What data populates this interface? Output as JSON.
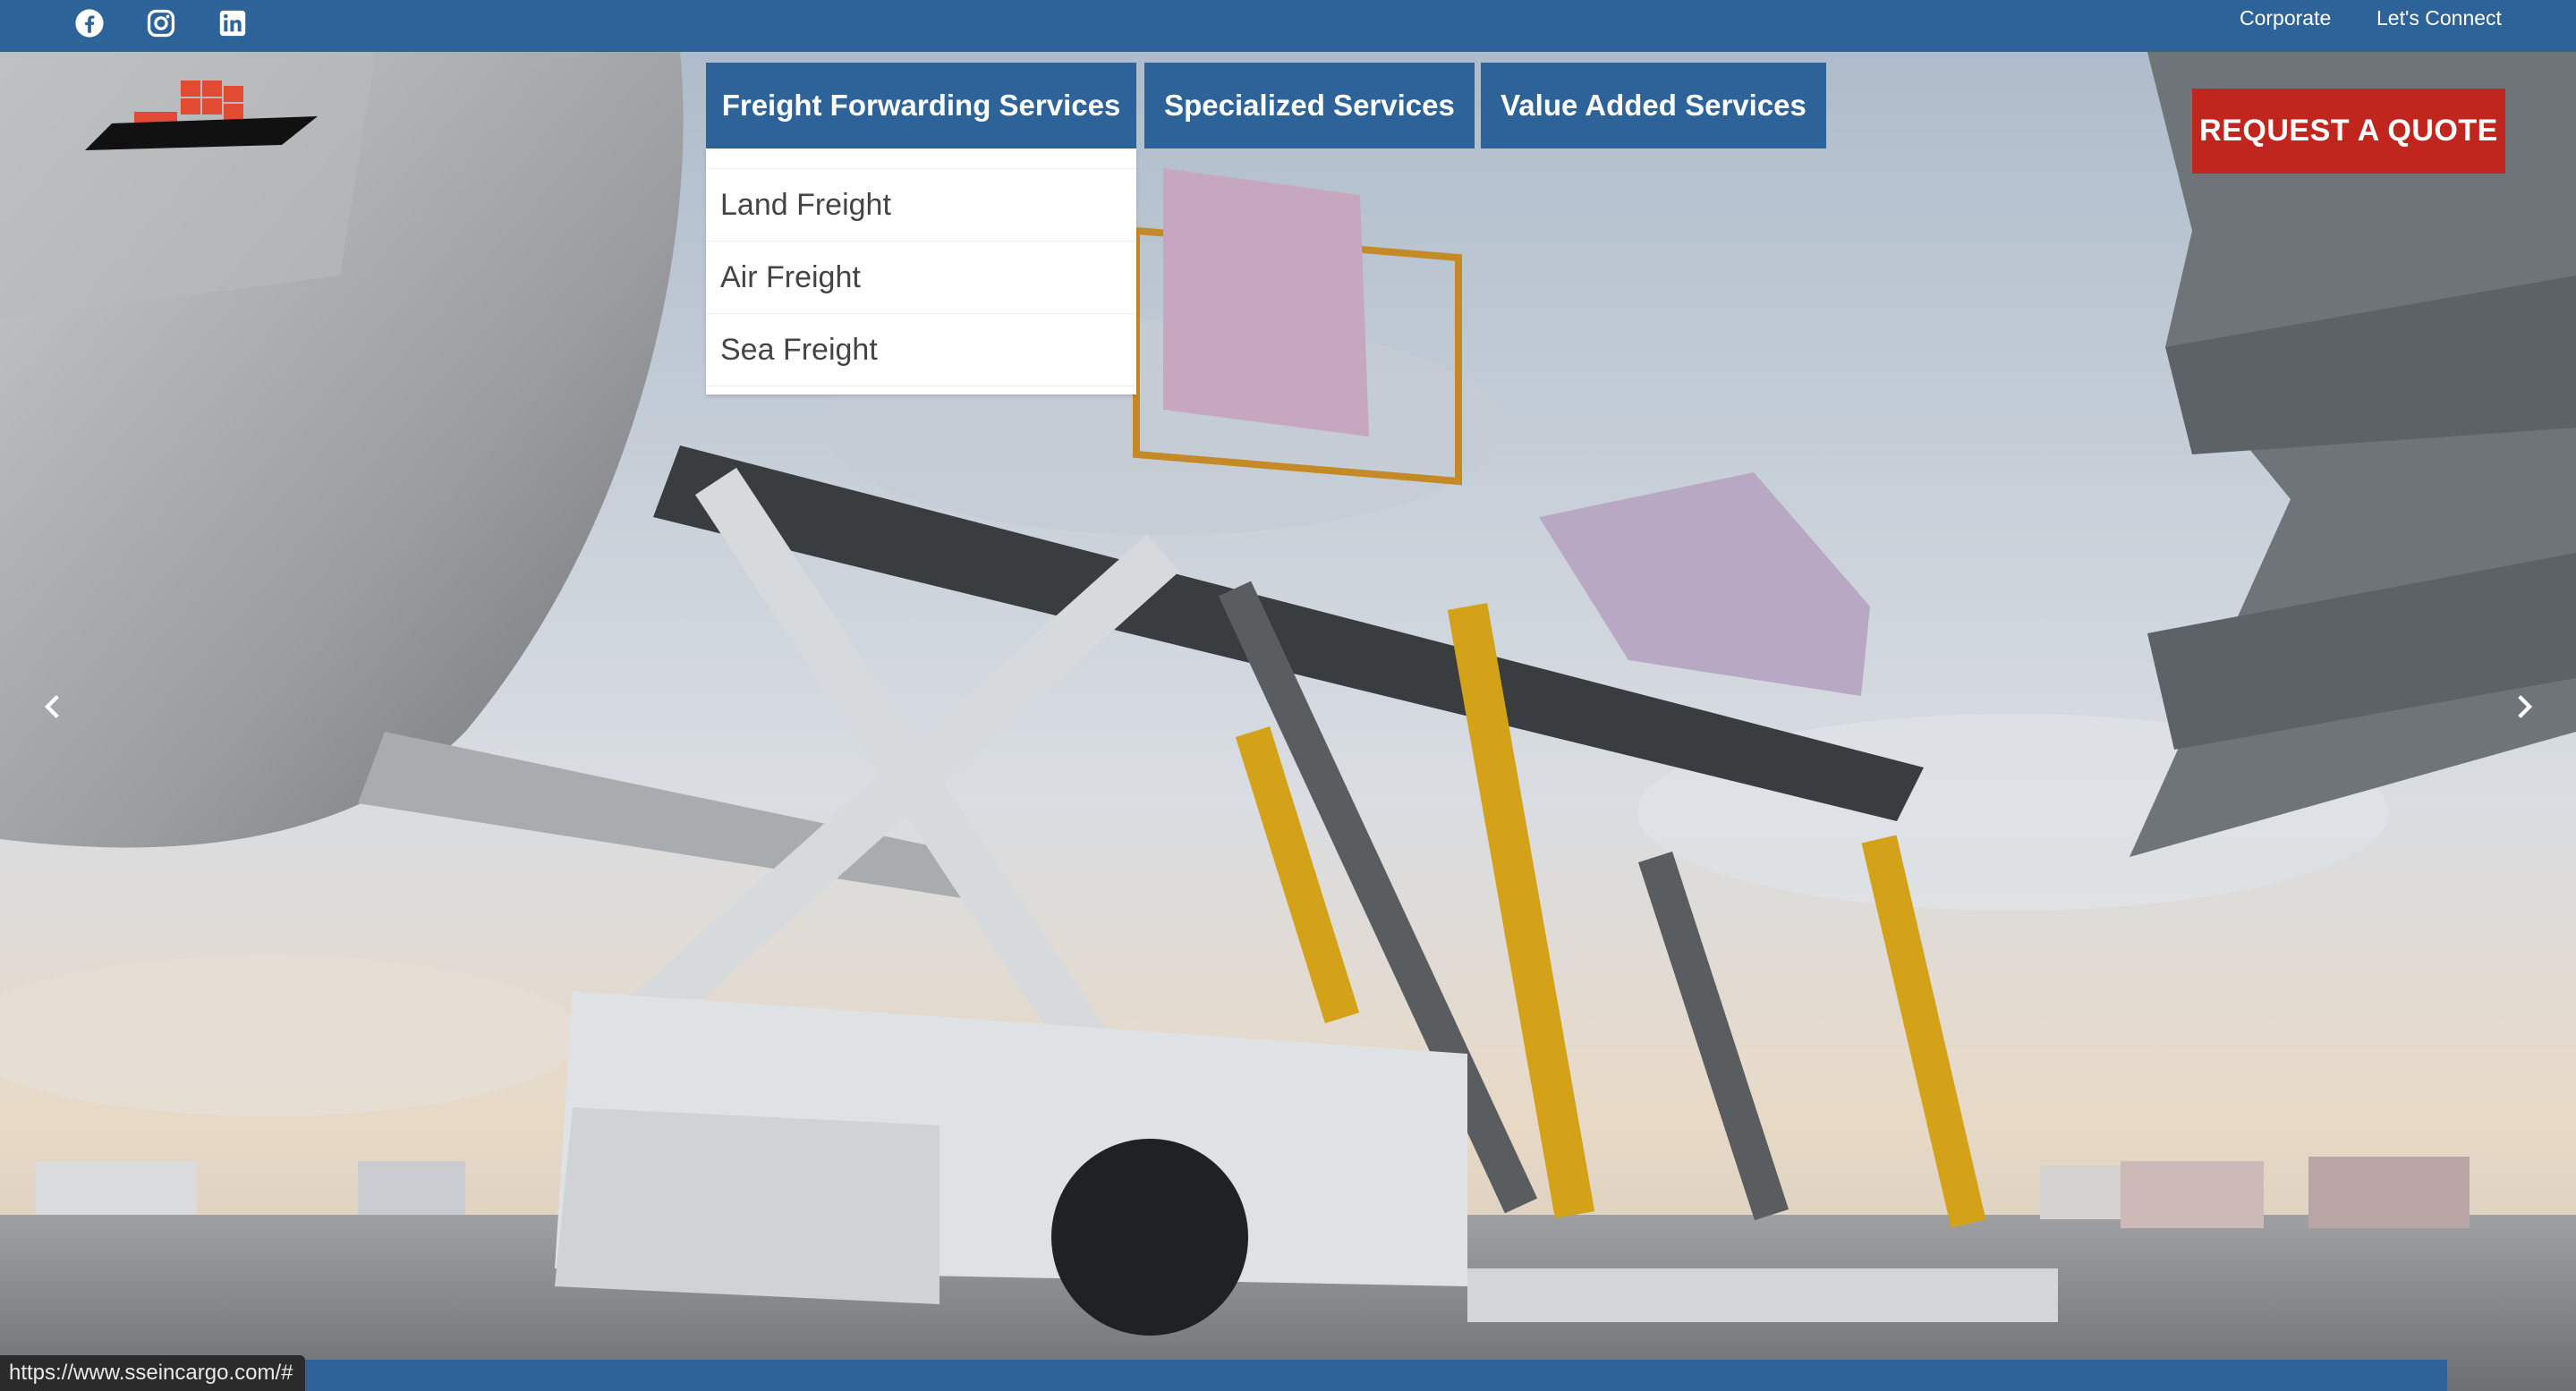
{
  "topbar": {
    "social_icons": [
      "facebook-icon",
      "instagram-icon",
      "linkedin-icon"
    ],
    "links": [
      "Corporate",
      "Let's Connect"
    ]
  },
  "nav": {
    "items": [
      "Freight Forwarding Services",
      "Specialized Services",
      "Value Added Services"
    ],
    "active_dropdown": [
      "Land Freight",
      "Air Freight",
      "Sea Freight"
    ]
  },
  "cta": {
    "label": "REQUEST A QUOTE"
  },
  "carousel": {
    "prev_icon": "chevron-left-icon",
    "next_icon": "chevron-right-icon"
  },
  "status_bar": {
    "url": "https://www.sseincargo.com/#"
  },
  "colors": {
    "brand_blue": "#2d6399",
    "cta_red": "#c0261e"
  }
}
